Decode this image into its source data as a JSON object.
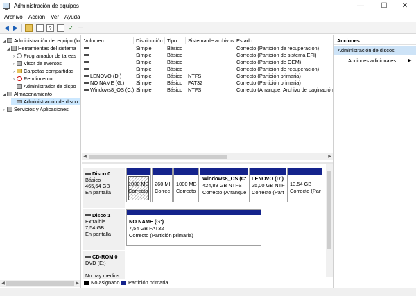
{
  "window": {
    "title": "Administración de equipos",
    "minimize_glyph": "—",
    "maximize_glyph": "☐",
    "close_glyph": "✕"
  },
  "menu": [
    "Archivo",
    "Acción",
    "Ver",
    "Ayuda"
  ],
  "toolbar_icons": [
    "back-arrow-icon",
    "forward-arrow-icon",
    "up-folder-icon",
    "show-tree-icon",
    "help-icon",
    "properties-icon",
    "check-icon",
    "refresh-icon"
  ],
  "toolbar": {
    "back": "◀",
    "forward": "▶",
    "check": "✓",
    "minus": "─"
  },
  "tree": [
    {
      "label": "Administración del equipo (loc",
      "exp": "◢",
      "icon": "tool",
      "indent": 0
    },
    {
      "label": "Herramientas del sistema",
      "exp": "◢",
      "icon": "tool",
      "indent": 1
    },
    {
      "label": "Programador de tareas",
      "exp": "›",
      "icon": "clock",
      "indent": 2
    },
    {
      "label": "Visor de eventos",
      "exp": "›",
      "icon": "tool",
      "indent": 2
    },
    {
      "label": "Carpetas compartidas",
      "exp": "›",
      "icon": "folder",
      "indent": 2
    },
    {
      "label": "Rendimiento",
      "exp": "›",
      "icon": "perf",
      "indent": 2
    },
    {
      "label": "Administrador de dispo",
      "exp": "",
      "icon": "tool",
      "indent": 2
    },
    {
      "label": "Almacenamiento",
      "exp": "◢",
      "icon": "tool",
      "indent": 0
    },
    {
      "label": "Administración de disco",
      "exp": "",
      "icon": "disk",
      "indent": 2,
      "selected": true
    },
    {
      "label": "Servicios y Aplicaciones",
      "exp": "›",
      "icon": "tool",
      "indent": 0
    }
  ],
  "volume_list": {
    "columns": [
      "Volumen",
      "Distribución",
      "Tipo",
      "Sistema de archivos",
      "Estado"
    ],
    "rows": [
      [
        "",
        "Simple",
        "Básico",
        "",
        "Correcto (Partición de recuperación)"
      ],
      [
        "",
        "Simple",
        "Básico",
        "",
        "Correcto (Partición de sistema EFI)"
      ],
      [
        "",
        "Simple",
        "Básico",
        "",
        "Correcto (Partición de OEM)"
      ],
      [
        "",
        "Simple",
        "Básico",
        "",
        "Correcto (Partición de recuperación)"
      ],
      [
        "LENOVO (D:)",
        "Simple",
        "Básico",
        "NTFS",
        "Correcto (Partición primaria)"
      ],
      [
        "NO NAME (G:)",
        "Simple",
        "Básico",
        "FAT32",
        "Correcto (Partición primaria)"
      ],
      [
        "Windows8_OS (C:)",
        "Simple",
        "Básico",
        "NTFS",
        "Correcto (Arranque, Archivo de paginación,"
      ]
    ]
  },
  "disks": [
    {
      "name": "Disco 0",
      "lines": [
        "Básico",
        "465,64 GB",
        "En pantalla"
      ],
      "partitions": [
        {
          "name": "",
          "lines": [
            "1000 MB",
            "Correcto"
          ],
          "hatched": true
        },
        {
          "name": "",
          "lines": [
            "260 MI",
            "Correc"
          ]
        },
        {
          "name": "",
          "lines": [
            "1000 MB",
            "Correcto"
          ]
        },
        {
          "name": "Windows8_OS (C:",
          "lines": [
            "424,89 GB NTFS",
            "Correcto (Arranque"
          ]
        },
        {
          "name": "LENOVO (D:)",
          "lines": [
            "25,00 GB NTFS",
            "Correcto (Part"
          ]
        },
        {
          "name": "",
          "lines": [
            "13,54 GB",
            "Correcto (Part"
          ]
        }
      ]
    },
    {
      "name": "Disco 1",
      "lines": [
        "Extraíble",
        "7,54 GB",
        "En pantalla"
      ],
      "partitions": [
        {
          "name": "NO NAME (G:)",
          "lines": [
            "7,54 GB FAT32",
            "Correcto (Partición primaria)"
          ]
        }
      ]
    },
    {
      "name": "CD-ROM 0",
      "lines": [
        "DVD (E:)",
        "",
        "No hay medios"
      ],
      "partitions": []
    }
  ],
  "legend": [
    {
      "label": "No asignado",
      "color": "#000000"
    },
    {
      "label": "Partición primaria",
      "color": "#14238c"
    }
  ],
  "actions": {
    "title": "Acciones",
    "section": "Administración de discos",
    "item": "Acciones adicionales",
    "arrow": "▶"
  },
  "colors": {
    "primary_partition": "#14238c",
    "selection": "#cce8ff",
    "actions_header": "#cde3f7"
  }
}
